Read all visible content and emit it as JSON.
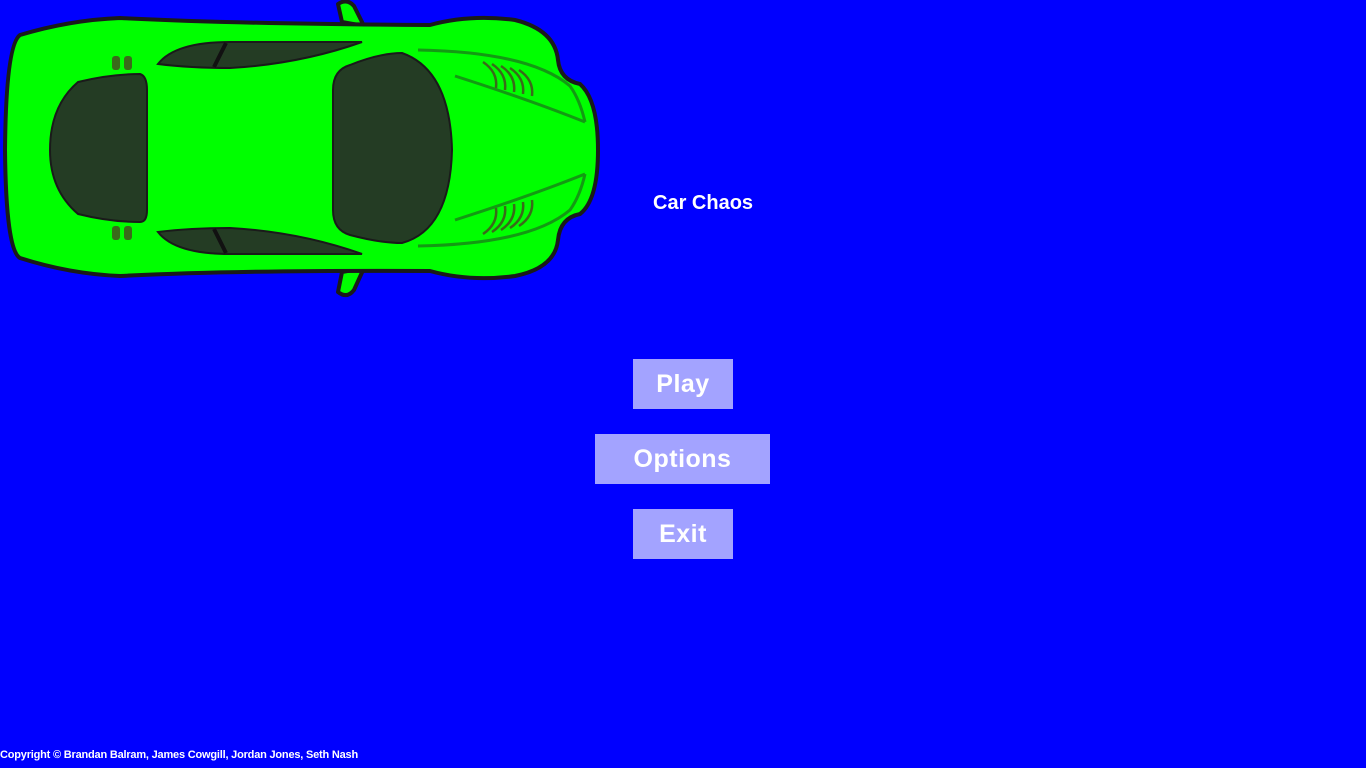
{
  "game": {
    "title": "Car Chaos",
    "background_color": "#0000ff",
    "car": {
      "icon": "car-icon",
      "body_color": "#00ff00",
      "window_color": "#243c24"
    }
  },
  "menu": {
    "button_color": "#a3a3ff",
    "play_label": "Play",
    "options_label": "Options",
    "exit_label": "Exit"
  },
  "footer": {
    "copyright": "Copyright © Brandan Balram, James Cowgill, Jordan Jones, Seth Nash"
  }
}
